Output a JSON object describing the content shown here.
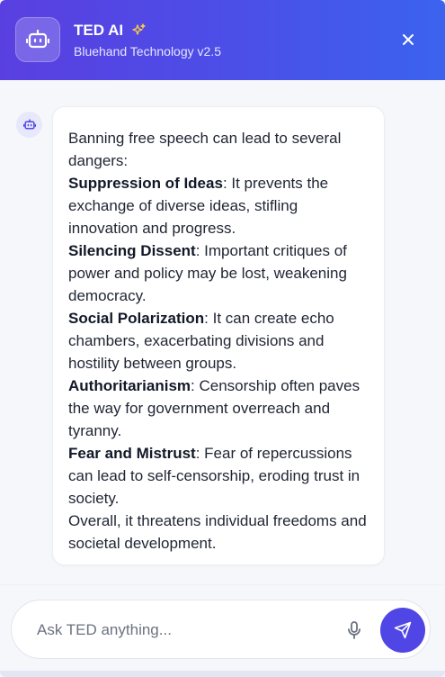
{
  "header": {
    "title": "TED AI",
    "subtitle": "Bluehand Technology v2.5",
    "icons": {
      "bot": "robot-icon",
      "sparkle": "sparkle-icon",
      "close": "close-icon"
    }
  },
  "message": {
    "intro": "Banning free speech can lead to several dangers:",
    "points": [
      {
        "term": "Suppression of Ideas",
        "text": ": It prevents the exchange of diverse ideas, stifling innovation and progress."
      },
      {
        "term": "Silencing Dissent",
        "text": ": Important critiques of power and policy may be lost, weakening democracy."
      },
      {
        "term": "Social Polarization",
        "text": ": It can create echo chambers, exacerbating divisions and hostility between groups."
      },
      {
        "term": "Authoritarianism",
        "text": ": Censorship often paves the way for government overreach and tyranny."
      },
      {
        "term": "Fear and Mistrust",
        "text": ": Fear of repercussions can lead to self-censorship, eroding trust in society."
      }
    ],
    "conclusion": "Overall, it threatens individual freedoms and societal development."
  },
  "composer": {
    "placeholder": "Ask TED anything...",
    "icons": {
      "mic": "microphone-icon",
      "send": "send-icon"
    }
  },
  "colors": {
    "header_gradient_start": "#5a3fe0",
    "header_gradient_end": "#3b63ef",
    "accent": "#4f46e5",
    "background": "#f6f7fb"
  }
}
